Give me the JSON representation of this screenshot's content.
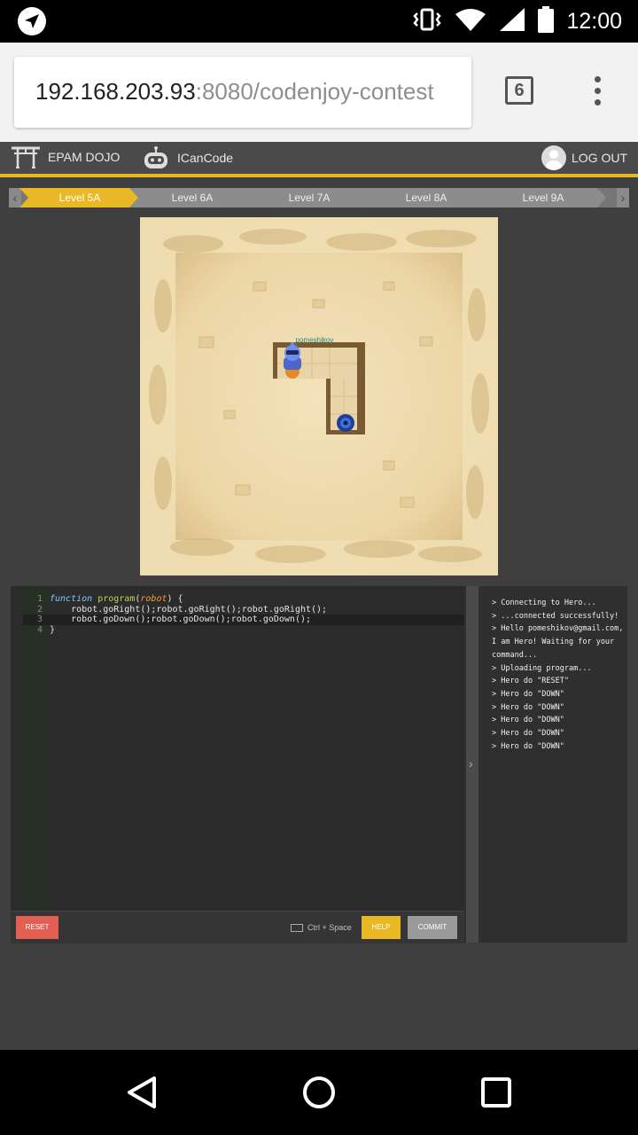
{
  "status_bar": {
    "time": "12:00"
  },
  "browser": {
    "url_host": "192.168.203.93",
    "url_path": ":8080/codenjoy-contest",
    "tab_count": "6"
  },
  "app_header": {
    "brand": "EPAM DOJO",
    "app_name": "ICanCode",
    "logout_label": "LOG OUT"
  },
  "levels": [
    "Level 5A",
    "Level 6A",
    "Level 7A",
    "Level 8A",
    "Level 9A"
  ],
  "game": {
    "player_name": "pomeshikov"
  },
  "editor": {
    "lines": [
      {
        "num": "1",
        "text": "function program(robot) {"
      },
      {
        "num": "2",
        "text": "    robot.goRight();robot.goRight();robot.goRight();"
      },
      {
        "num": "3",
        "text": "    robot.goDown();robot.goDown();robot.goDown();"
      },
      {
        "num": "4",
        "text": "}"
      }
    ],
    "reset_label": "RESET",
    "shortcut_hint": "Ctrl + Space",
    "help_label": "HELP",
    "commit_label": "COMMIT"
  },
  "console": {
    "lines": [
      "> Connecting to Hero...",
      "> ...connected successfully!",
      "> Hello pomeshikov@gmail.com, I am Hero! Waiting for your command...",
      "> Uploading program...",
      "> Hero do \"RESET\"",
      "> Hero do \"DOWN\"",
      "> Hero do \"DOWN\"",
      "> Hero do \"DOWN\"",
      "> Hero do \"DOWN\"",
      "> Hero do \"DOWN\""
    ]
  }
}
